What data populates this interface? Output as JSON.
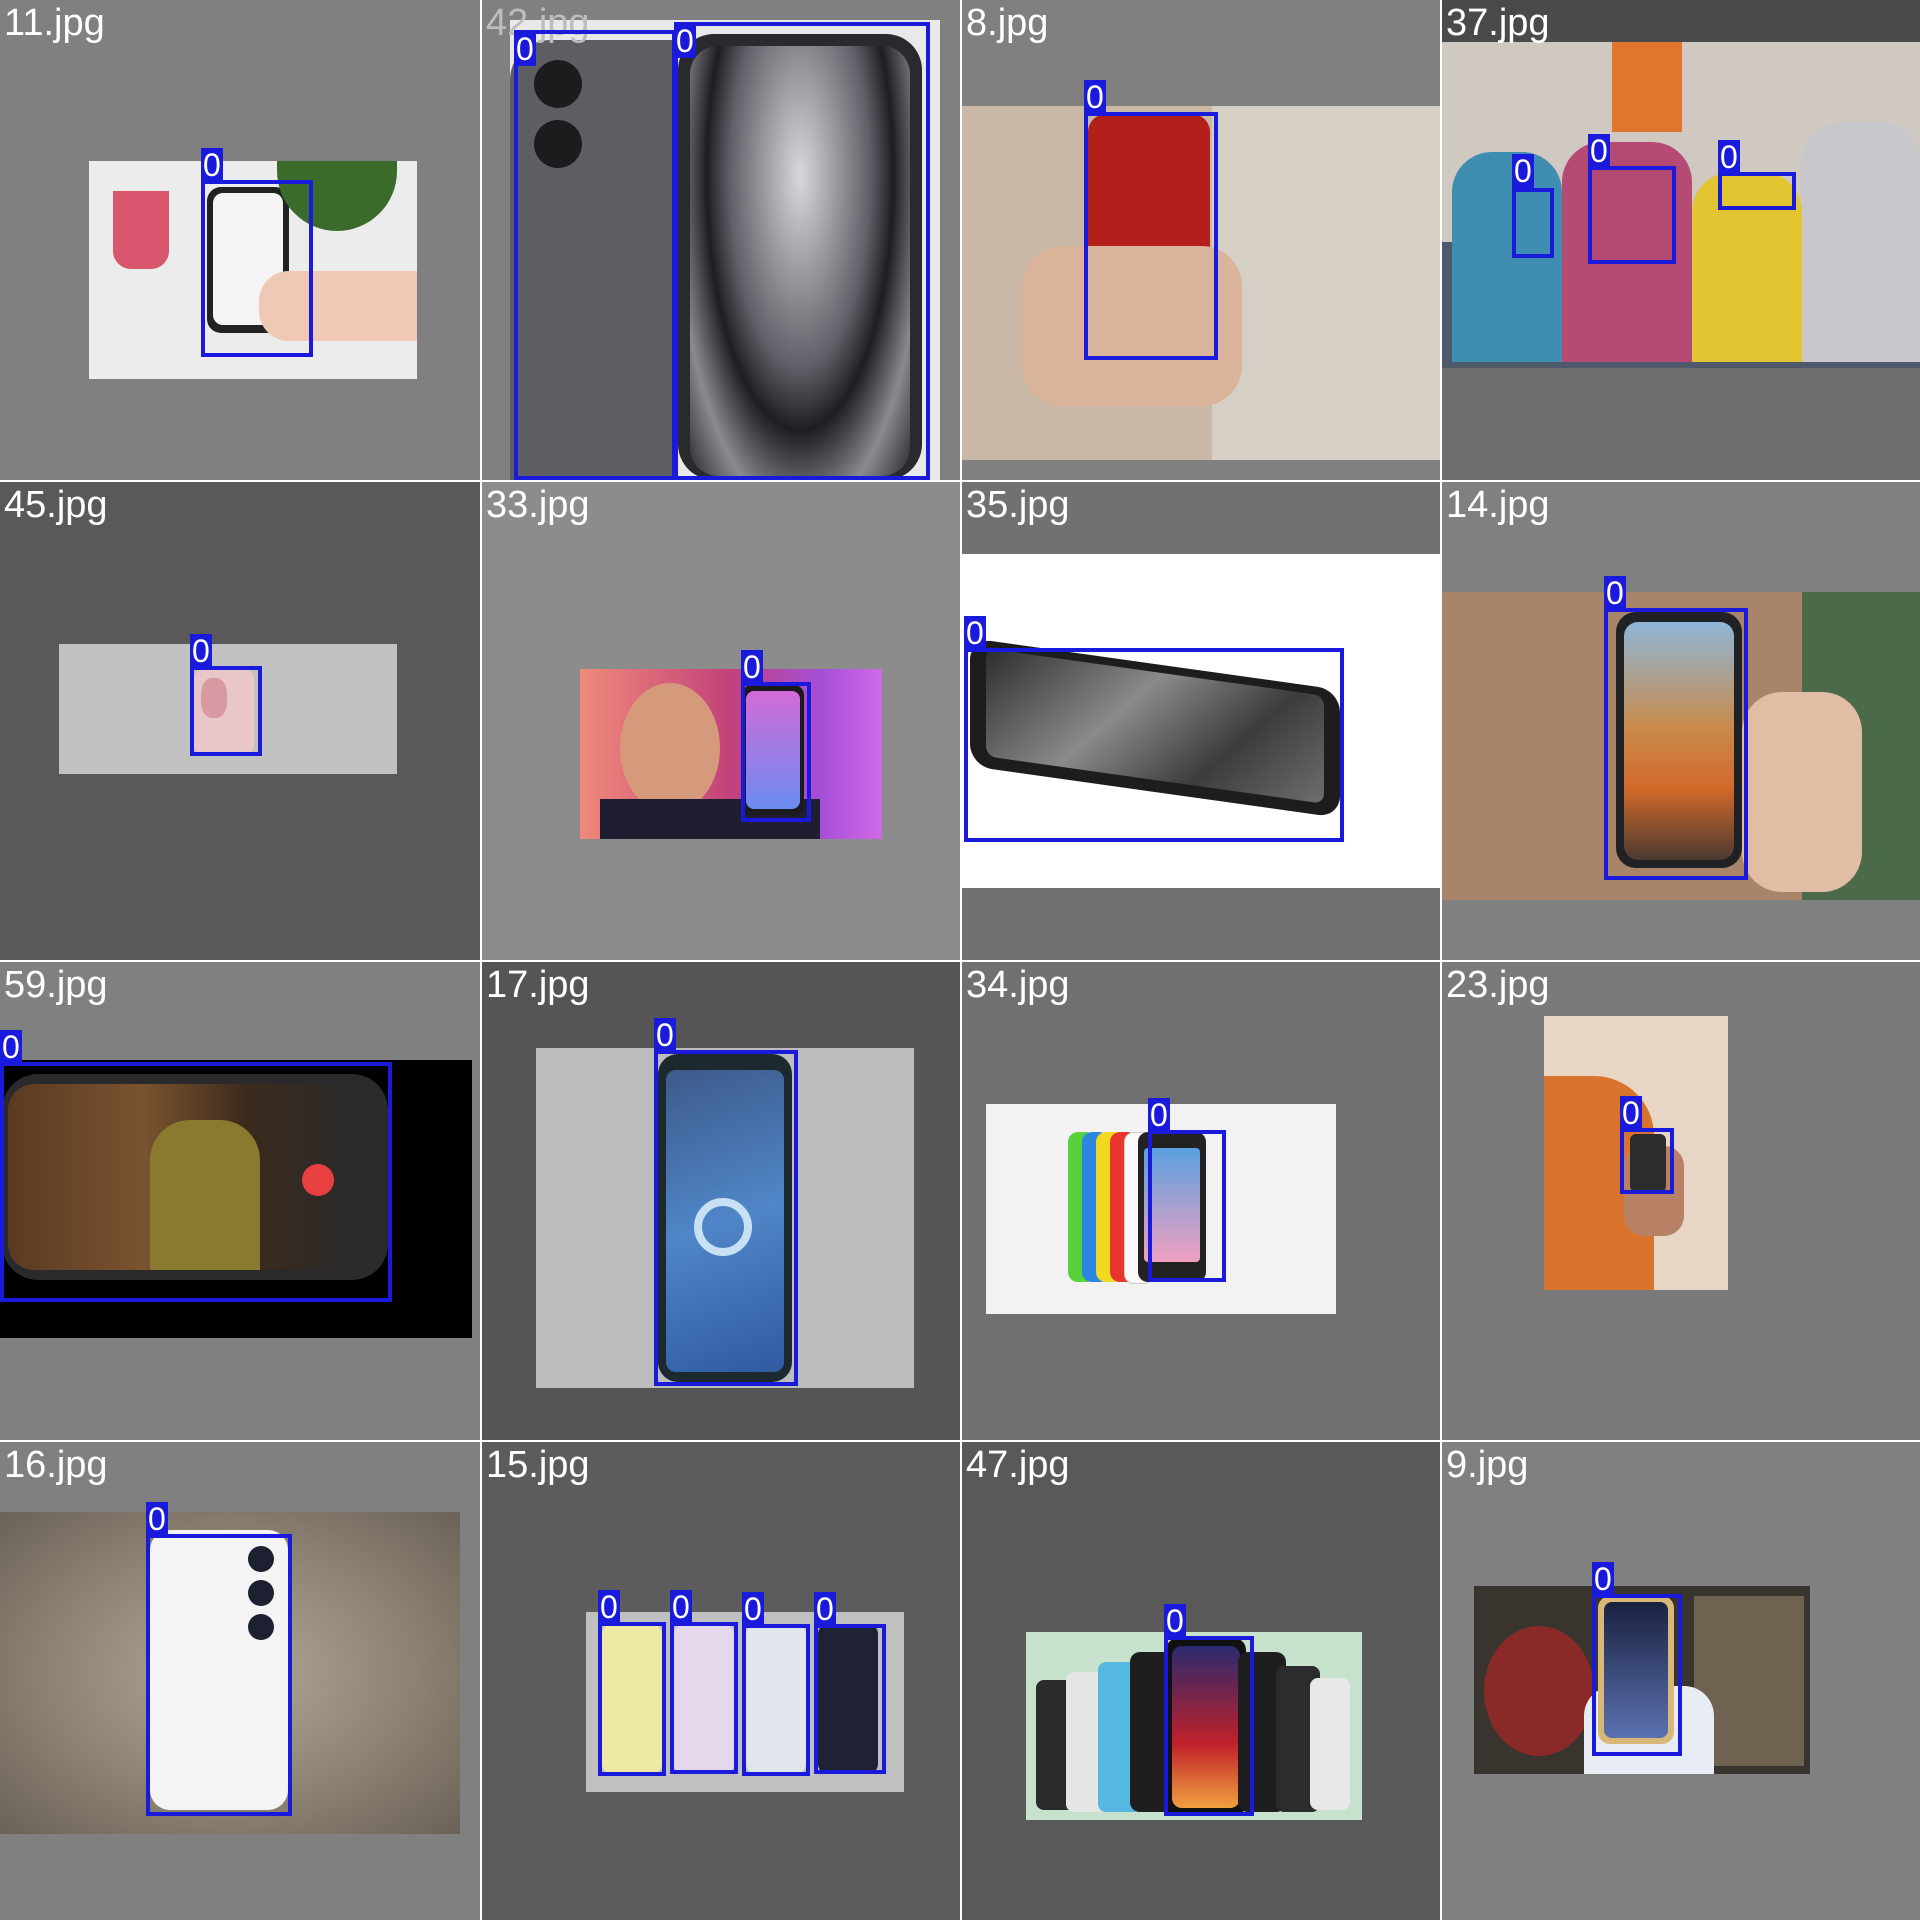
{
  "colors": {
    "box": "#1a1adc"
  },
  "tiles": [
    {
      "name": "11.jpg",
      "labels": [
        "0"
      ]
    },
    {
      "name": "42.jpg",
      "labels": [
        "0",
        "0"
      ]
    },
    {
      "name": "8.jpg",
      "labels": [
        "0"
      ]
    },
    {
      "name": "37.jpg",
      "labels": [
        "0",
        "0",
        "0"
      ]
    },
    {
      "name": "45.jpg",
      "labels": [
        "0"
      ]
    },
    {
      "name": "33.jpg",
      "labels": [
        "0"
      ]
    },
    {
      "name": "35.jpg",
      "labels": [
        "0"
      ]
    },
    {
      "name": "14.jpg",
      "labels": [
        "0"
      ]
    },
    {
      "name": "59.jpg",
      "labels": [
        "0"
      ]
    },
    {
      "name": "17.jpg",
      "labels": [
        "0"
      ]
    },
    {
      "name": "34.jpg",
      "labels": [
        "0"
      ]
    },
    {
      "name": "23.jpg",
      "labels": [
        "0"
      ]
    },
    {
      "name": "16.jpg",
      "labels": [
        "0"
      ]
    },
    {
      "name": "15.jpg",
      "labels": [
        "0",
        "0",
        "0",
        "0"
      ]
    },
    {
      "name": "47.jpg",
      "labels": [
        "0"
      ]
    },
    {
      "name": "9.jpg",
      "labels": [
        "0"
      ]
    }
  ]
}
